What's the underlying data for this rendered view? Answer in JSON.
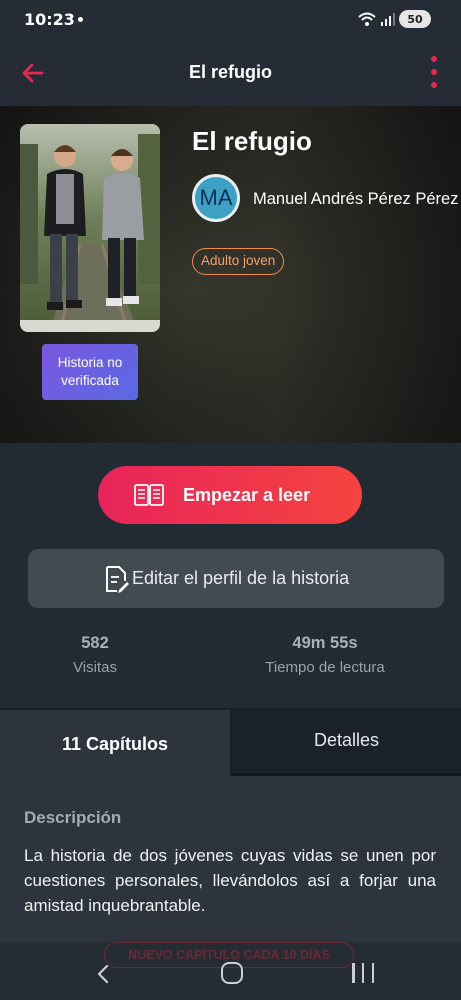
{
  "status_bar": {
    "time": "10:23",
    "battery": "50"
  },
  "app_bar": {
    "title": "El refugio"
  },
  "story": {
    "title": "El refugio",
    "author_initials": "MA",
    "author_name": "Manuel Andrés Pérez Pérez",
    "genre": "Adulto joven",
    "verification": "Historia no verificada"
  },
  "actions": {
    "start_label": "Empezar a leer",
    "edit_label": "Editar el perfil de la historia"
  },
  "stats": {
    "visits_value": "582",
    "visits_label": "Visitas",
    "reading_time_value": "49m 55s",
    "reading_time_label": "Tiempo de lectura"
  },
  "tabs": [
    {
      "label": "11 Capítulos",
      "selected": true
    },
    {
      "label": "Detalles",
      "selected": false
    }
  ],
  "description": {
    "heading": "Descripción",
    "text": "La historia de dos jóvenes cuyas vidas se unen por cuestiones personales, llevándolos así a forjar una amistad inquebrantable."
  },
  "schedule_badge": "NUEVO CAPÍTULO CADA 10 DÍAS",
  "colors": {
    "accent": "#e8264f",
    "background": "#222a33",
    "verify_badge": "#6a5ee0",
    "genre_tag": "#f08a4b"
  },
  "icons": [
    "back-arrow-icon",
    "more-vert-icon",
    "book-icon",
    "edit-document-icon",
    "wifi-icon",
    "signal-icon",
    "battery-icon"
  ]
}
